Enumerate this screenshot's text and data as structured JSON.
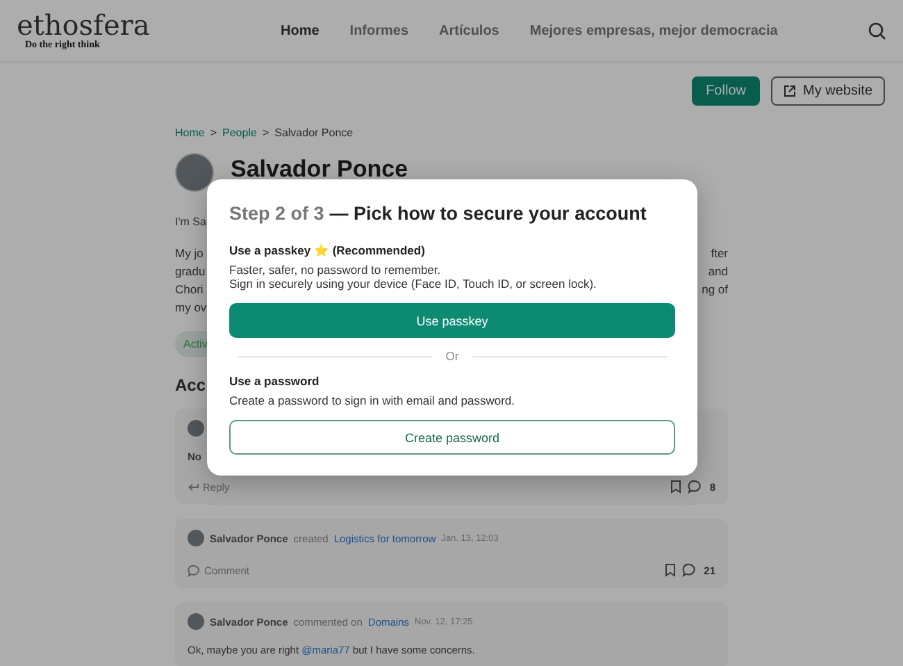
{
  "header": {
    "logo": "ethosfera",
    "tagline": "Do the right think",
    "nav": [
      {
        "label": "Home",
        "selected": true
      },
      {
        "label": "Informes",
        "selected": false
      },
      {
        "label": "Artículos",
        "selected": false
      },
      {
        "label": "Mejores empresas, mejor democracia",
        "selected": false
      }
    ]
  },
  "actions": {
    "follow": "Follow",
    "website": "My website"
  },
  "breadcrumb": {
    "links": [
      "Home",
      "People"
    ],
    "separator": ">",
    "current": "Salvador Ponce"
  },
  "profile": {
    "name": "Salvador Ponce",
    "intro": "I'm Sa",
    "bio_lines": [
      {
        "left": "My jo",
        "right": "fter"
      },
      {
        "left": "gradu",
        "right": "and"
      },
      {
        "left": "Chori",
        "right": "ng of"
      },
      {
        "left": "my ov"
      }
    ],
    "tag": "Activ",
    "section_title": "Acc"
  },
  "feed": [
    {
      "kind": "partial",
      "text": "No",
      "action": "Reply",
      "count": "8"
    },
    {
      "kind": "created",
      "author": "Salvador Ponce",
      "verb": "created",
      "target": "Logistics for tomorrow",
      "date": "Jan. 13, 12:03",
      "action": "Comment",
      "count": "21"
    },
    {
      "kind": "comment",
      "author": "Salvador Ponce",
      "verb": "commented on",
      "target": "Domains",
      "date": "Nov. 12, 17:25",
      "text_before": "Ok, maybe you are right ",
      "mention": "@maria77",
      "text_after": " but I have some concerns."
    }
  ],
  "modal": {
    "step": "Step 2 of 3",
    "title": "— Pick how to secure your account",
    "passkey_heading": "Use a passkey ⭐ (Recommended)",
    "passkey_lines": [
      "Faster, safer, no password to remember.",
      "Sign in securely using your device (Face ID, Touch ID, or screen lock)."
    ],
    "passkey_button": "Use passkey",
    "divider": "Or",
    "password_heading": "Use a password",
    "password_text": "Create a password to sign in with email and password.",
    "password_button": "Create password"
  }
}
